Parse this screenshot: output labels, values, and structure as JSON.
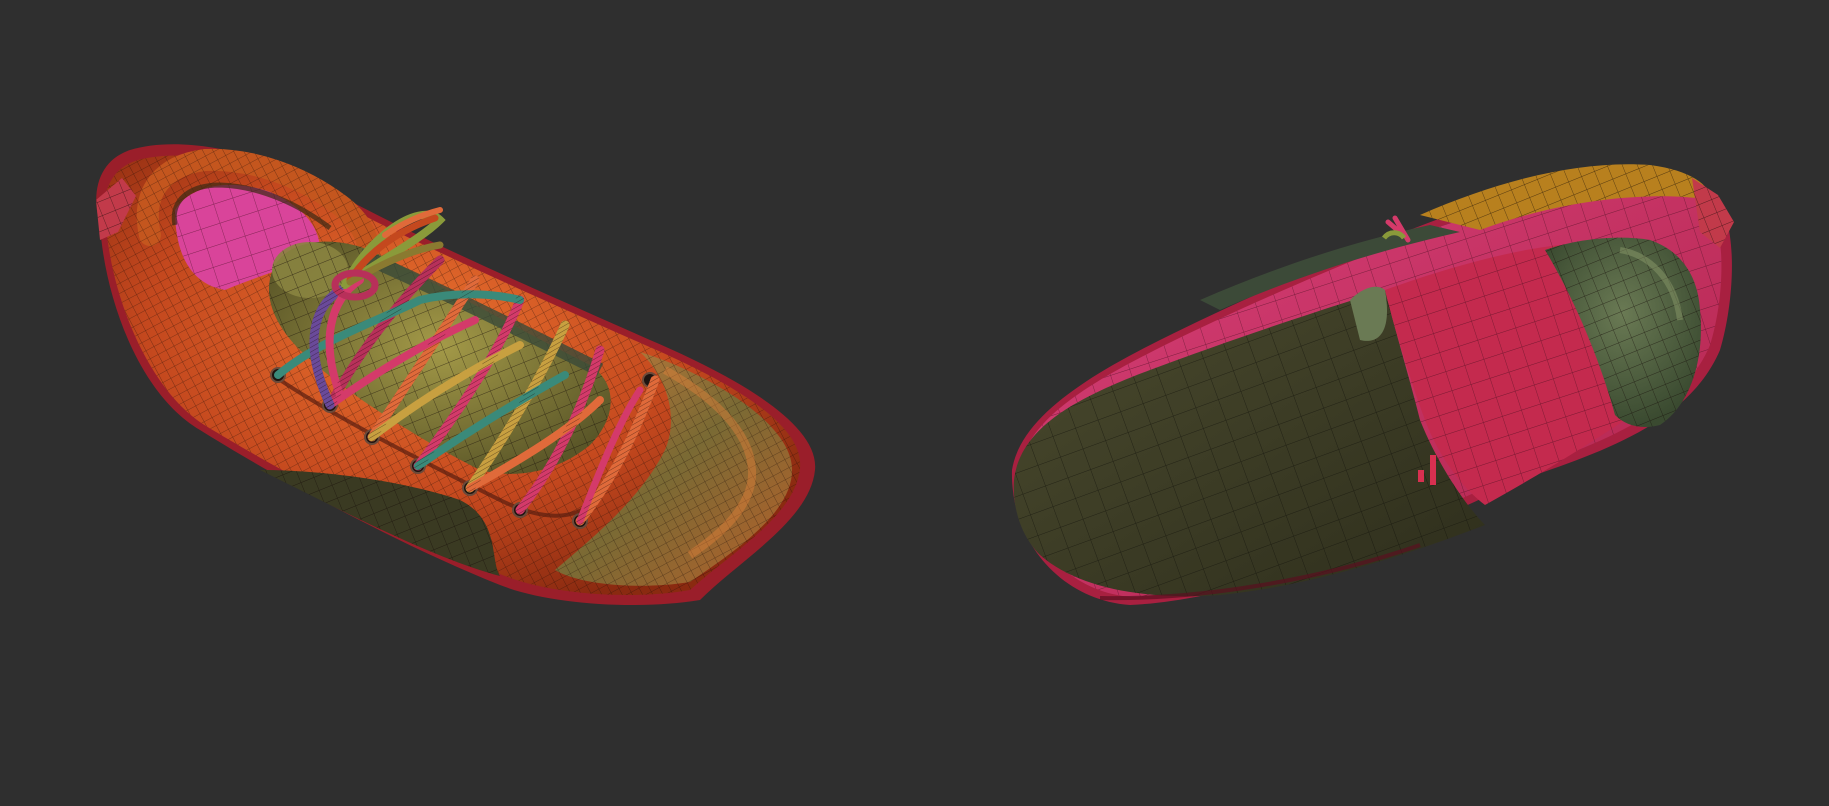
{
  "scene": {
    "background": "#2f2f2f",
    "objects": [
      {
        "name": "shoe-top-view",
        "polygroup_colors": [
          "#c4481e",
          "#e0622a",
          "#c23a6a",
          "#d9449a",
          "#5a5a2c",
          "#8a8a3a",
          "#3c4a38",
          "#b82838"
        ]
      },
      {
        "name": "shoe-sole-view",
        "polygroup_colors": [
          "#c42a4e",
          "#d63a78",
          "#4a4a2c",
          "#5a6a48",
          "#b8801e",
          "#a82040"
        ]
      }
    ],
    "lace_colors": [
      "#d43a6a",
      "#e06a3a",
      "#6a4a9a",
      "#8a9a3a",
      "#3a8a7a",
      "#c8a040",
      "#b8305a"
    ]
  }
}
